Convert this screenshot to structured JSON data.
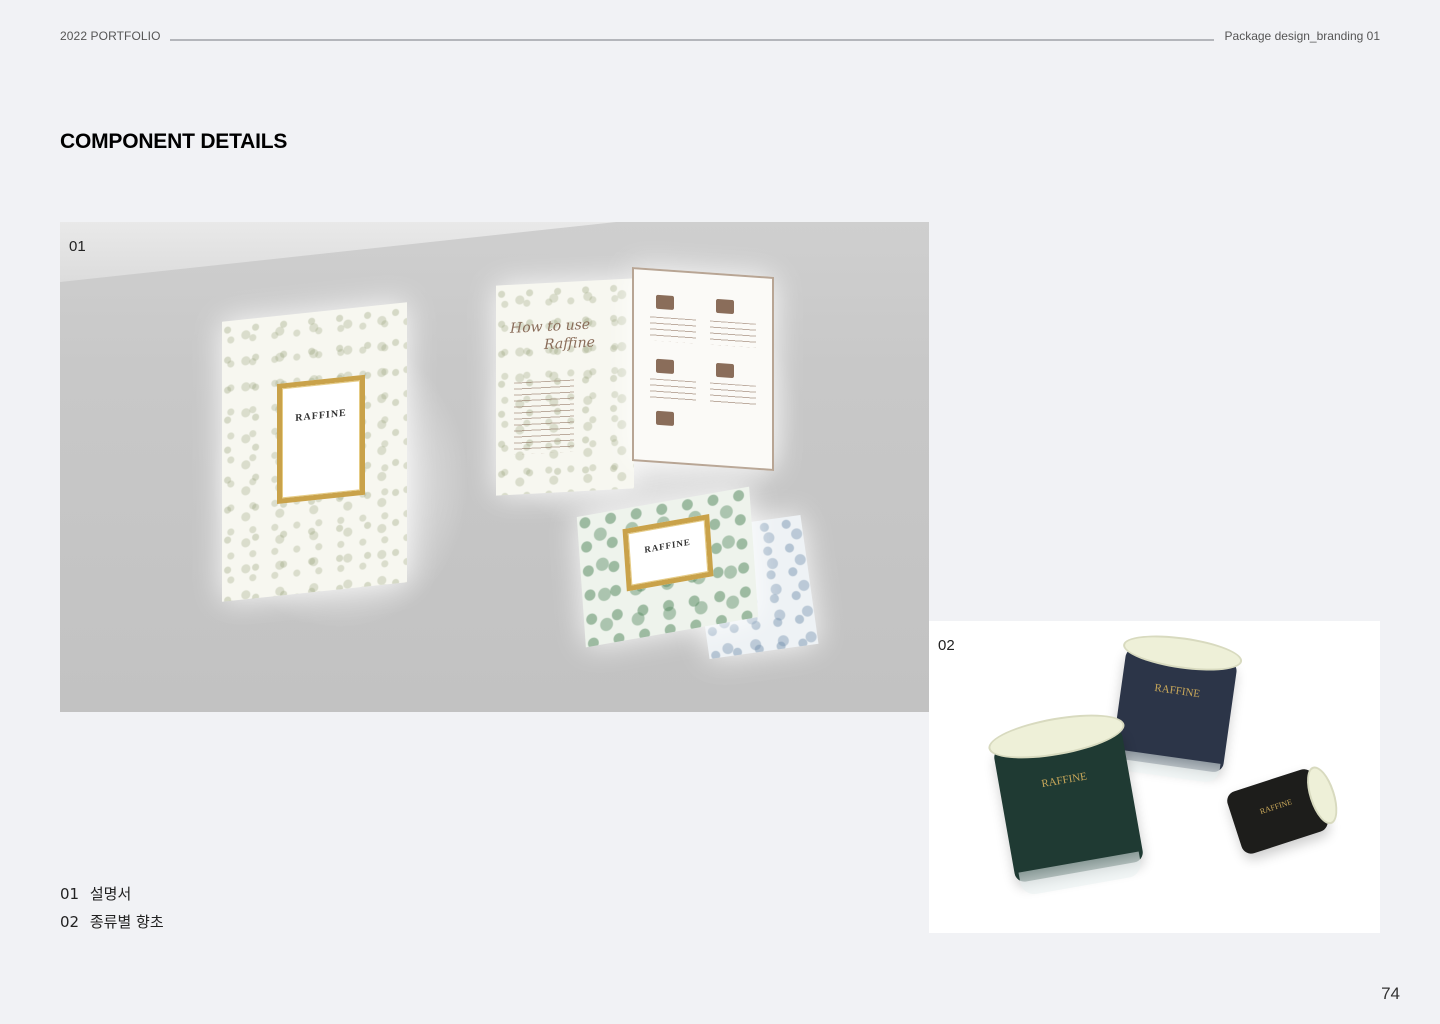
{
  "header": {
    "left_text": "2022 PORTFOLIO",
    "right_text": "Package design_branding 01"
  },
  "section_title": "COMPONENT DETAILS",
  "photos": [
    {
      "label": "01",
      "brand": "RAFFINE",
      "script_title_1": "How to use",
      "script_title_2": "Raffine"
    },
    {
      "label": "02",
      "brand": "RAFFINE"
    }
  ],
  "captions": [
    {
      "num": "01",
      "text": "설명서"
    },
    {
      "num": "02",
      "text": "종류별 향초"
    }
  ],
  "page_number": "74",
  "colors": {
    "background": "#f1f2f5",
    "gold": "#c9a24a",
    "jar_green": "#1f3a33",
    "jar_navy": "#2c3548",
    "jar_black": "#1d1d1b"
  }
}
